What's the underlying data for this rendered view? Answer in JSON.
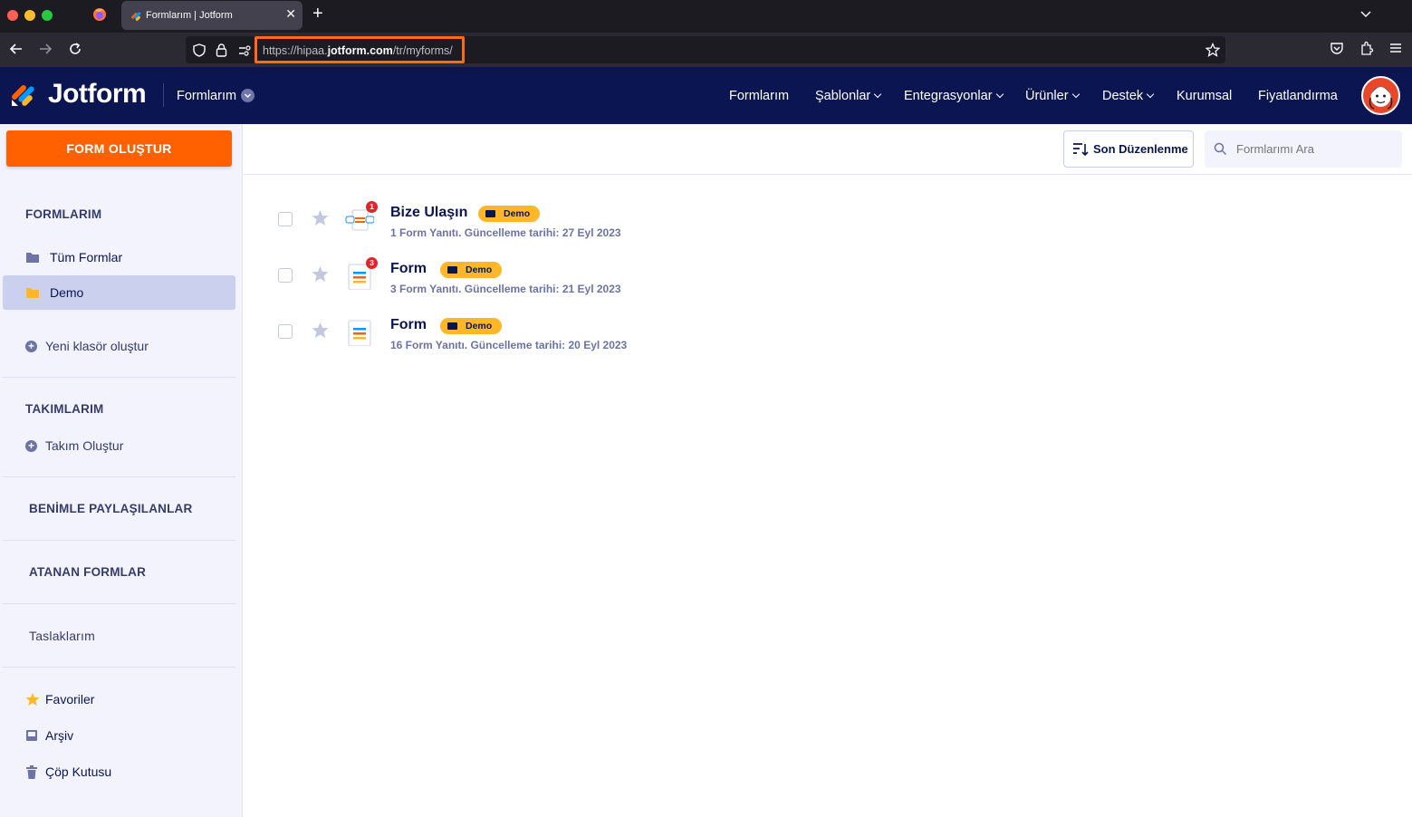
{
  "browser": {
    "tab_title": "Formlarım | Jotform",
    "url_prefix": "https://hipaa.",
    "url_domain": "jotform.com",
    "url_path": "/tr/myforms/",
    "highlight_color": "#ff6a13"
  },
  "header": {
    "logo_text": "Jotform",
    "workspace": "Formlarım",
    "nav": [
      {
        "label": "Formlarım",
        "has_menu": false
      },
      {
        "label": "Şablonlar",
        "has_menu": true
      },
      {
        "label": "Entegrasyonlar",
        "has_menu": true
      },
      {
        "label": "Ürünler",
        "has_menu": true
      },
      {
        "label": "Destek",
        "has_menu": true
      },
      {
        "label": "Kurumsal",
        "has_menu": false
      },
      {
        "label": "Fiyatlandırma",
        "has_menu": false
      }
    ]
  },
  "sidebar": {
    "create_button": "FORM OLUŞTUR",
    "my_forms_title": "FORMLARIM",
    "folders": [
      {
        "label": "Tüm Formlar",
        "icon": "folder-icon",
        "active": false
      },
      {
        "label": "Demo",
        "icon": "folder-icon",
        "active": true
      }
    ],
    "new_folder": "Yeni klasör oluştur",
    "teams_title": "TAKIMLARIM",
    "create_team": "Takım Oluştur",
    "shared_title": "BENİMLE PAYLAŞILANLAR",
    "assigned_title": "ATANAN FORMLAR",
    "drafts": "Taslaklarım",
    "favorites": "Favoriler",
    "archive": "Arşiv",
    "trash": "Çöp Kutusu"
  },
  "toolbar": {
    "sort_label": "Son Düzenlenme",
    "search_placeholder": "Formlarımı Ara"
  },
  "forms": [
    {
      "title": "Bize Ulaşın",
      "folder": "Demo",
      "badge": "1",
      "meta": "1 Form Yanıtı. Güncelleme tarihi: 27 Eyl 2023"
    },
    {
      "title": "Form",
      "folder": "Demo",
      "badge": "3",
      "meta": "3 Form Yanıtı. Güncelleme tarihi: 21 Eyl 2023"
    },
    {
      "title": "Form",
      "folder": "Demo",
      "badge": "",
      "meta": "16 Form Yanıtı. Güncelleme tarihi: 20 Eyl 2023"
    }
  ],
  "colors": {
    "header_bg": "#0a1551",
    "create_button": "#ff6100",
    "folder_tag": "#ffb629",
    "sidebar_bg": "#f3f3fe",
    "active_folder_bg": "#ccd0ef"
  }
}
